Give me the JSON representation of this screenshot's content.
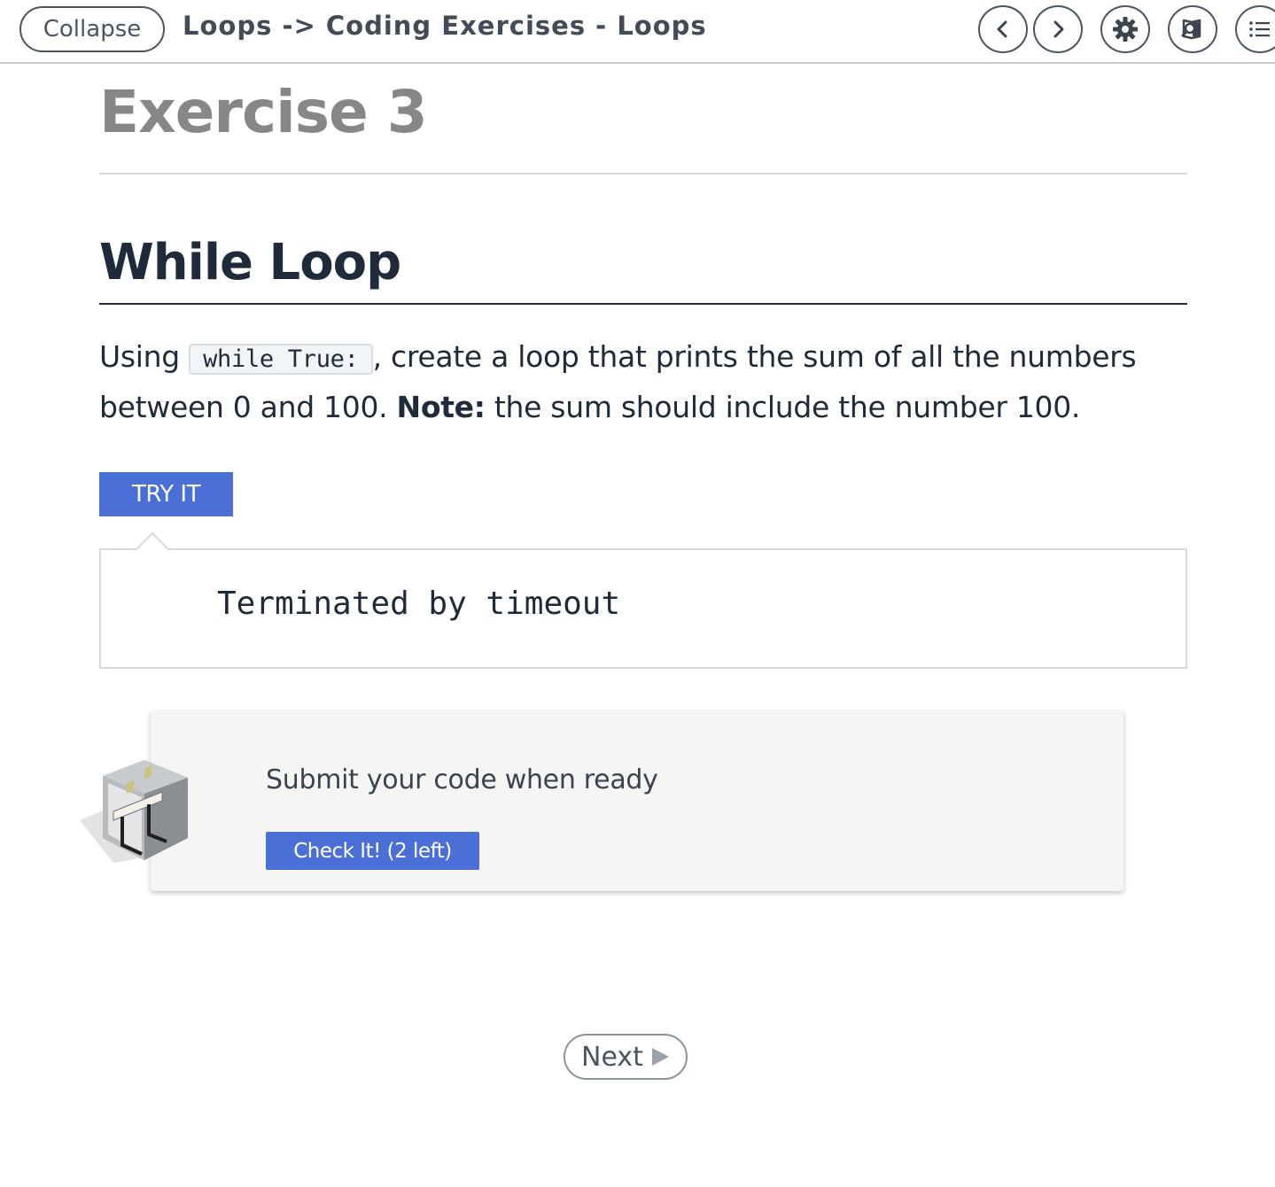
{
  "topbar": {
    "collapse_label": "Collapse",
    "breadcrumb": "Loops -> Coding Exercises - Loops",
    "icons": [
      "chevron-left-icon",
      "chevron-right-icon",
      "gear-icon",
      "search-book-icon",
      "list-icon"
    ]
  },
  "header": {
    "exercise_title": "Exercise 3"
  },
  "content": {
    "section_title": "While Loop",
    "instr_before": "Using ",
    "instr_code": "while True:",
    "instr_after": ", create a loop that prints the sum of all the numbers between 0 and 100. ",
    "note_label": "Note:",
    "note_text": " the sum should include the number 100."
  },
  "try_it": {
    "button_label": "TRY IT",
    "output": "Terminated by timeout"
  },
  "submit": {
    "prompt": "Submit your code when ready",
    "check_label": "Check It! (2 left)"
  },
  "nav": {
    "next_label": "Next"
  },
  "colors": {
    "accent": "#4a6fd6",
    "text": "#1f2a3a",
    "muted_title": "#878787"
  }
}
